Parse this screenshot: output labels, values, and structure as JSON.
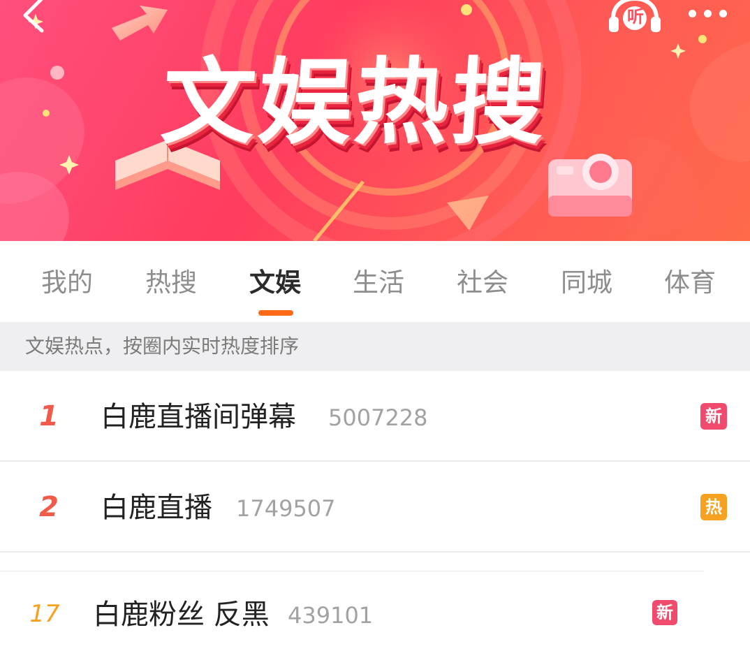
{
  "header": {
    "banner_title": "文娱热搜",
    "listen_label": "听"
  },
  "tabs": [
    {
      "label": "我的",
      "active": false
    },
    {
      "label": "热搜",
      "active": false
    },
    {
      "label": "文娱",
      "active": true
    },
    {
      "label": "生活",
      "active": false
    },
    {
      "label": "社会",
      "active": false
    },
    {
      "label": "同城",
      "active": false
    },
    {
      "label": "体育",
      "active": false
    }
  ],
  "subtitle": "文娱热点，按圈内实时热度排序",
  "list": [
    {
      "rank": "1",
      "title": "白鹿直播间弹幕",
      "count": "5007228",
      "badge": "新",
      "badge_color": "#f04a6c",
      "rank_color": "#f25a4a"
    },
    {
      "rank": "2",
      "title": "白鹿直播",
      "count": "1749507",
      "badge": "热",
      "badge_color": "#f7a120",
      "rank_color": "#f25a4a"
    },
    {
      "rank": "17",
      "title": "白鹿粉丝 反黑",
      "count": "439101",
      "badge": "新",
      "badge_color": "#f04a6c",
      "rank_color": "#f7a120"
    }
  ],
  "colors": {
    "accent": "#ff6a1a",
    "banner_main": "#ff3d5e"
  }
}
